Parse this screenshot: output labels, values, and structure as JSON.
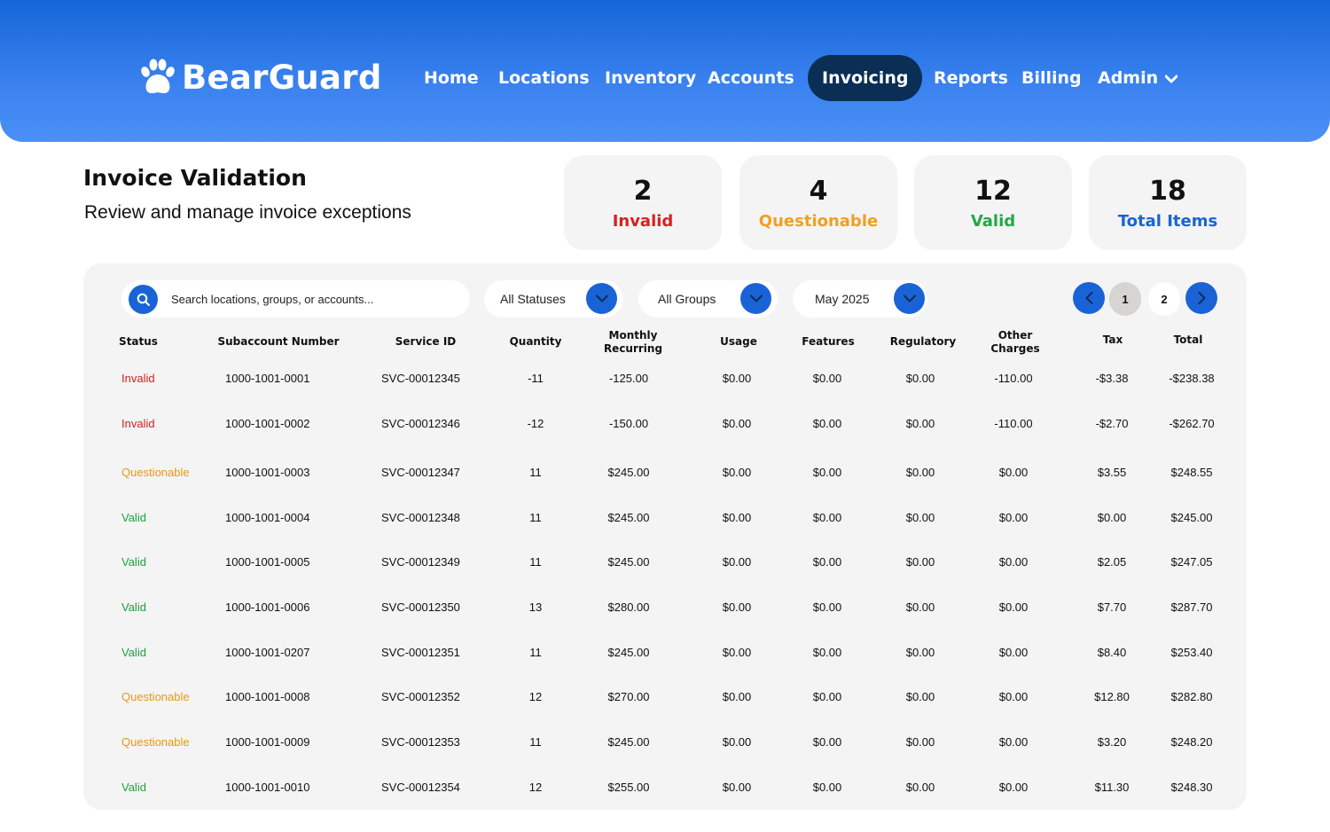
{
  "brand": {
    "name": "BearGuard",
    "logo_icon": "paw-icon"
  },
  "nav": {
    "items": [
      "Home",
      "Locations",
      "Inventory",
      "Accounts",
      "Invoicing",
      "Reports",
      "Billing",
      "Admin"
    ],
    "active": "Invoicing"
  },
  "page": {
    "title": "Invoice Validation",
    "subtitle": "Review and manage invoice exceptions"
  },
  "stats": [
    {
      "value": "2",
      "label": "Invalid",
      "color": "#d92020"
    },
    {
      "value": "4",
      "label": "Questionable",
      "color": "#f0a020"
    },
    {
      "value": "12",
      "label": "Valid",
      "color": "#22a845"
    },
    {
      "value": "18",
      "label": "Total Items",
      "color": "#1a63d6"
    }
  ],
  "filters": {
    "search_placeholder": "Search locations, groups, or accounts...",
    "status": "All Statuses",
    "group": "All Groups",
    "period": "May 2025"
  },
  "pagination": {
    "pages": [
      "1",
      "2"
    ],
    "current": "1"
  },
  "table": {
    "columns": [
      "Status",
      "Subaccount Number",
      "Service ID",
      "Quantity",
      "Monthly Recurring",
      "Usage",
      "Features",
      "Regulatory",
      "Other Charges",
      "Tax",
      "Total"
    ],
    "rows": [
      [
        "Invalid",
        "1000-1001-0001",
        "SVC-00012345",
        "-11",
        "-125.00",
        "$0.00",
        "$0.00",
        "$0.00",
        "-110.00",
        "-$3.38",
        "-$238.38"
      ],
      [
        "Invalid",
        "1000-1001-0002",
        "SVC-00012346",
        "-12",
        "-150.00",
        "$0.00",
        "$0.00",
        "$0.00",
        "-110.00",
        "-$2.70",
        "-$262.70"
      ],
      [
        "Questionable",
        "1000-1001-0003",
        "SVC-00012347",
        "11",
        "$245.00",
        "$0.00",
        "$0.00",
        "$0.00",
        "$0.00",
        "$3.55",
        "$248.55"
      ],
      [
        "Valid",
        "1000-1001-0004",
        "SVC-00012348",
        "11",
        "$245.00",
        "$0.00",
        "$0.00",
        "$0.00",
        "$0.00",
        "$0.00",
        "$245.00"
      ],
      [
        "Valid",
        "1000-1001-0005",
        "SVC-00012349",
        "11",
        "$245.00",
        "$0.00",
        "$0.00",
        "$0.00",
        "$0.00",
        "$2.05",
        "$247.05"
      ],
      [
        "Valid",
        "1000-1001-0006",
        "SVC-00012350",
        "13",
        "$280.00",
        "$0.00",
        "$0.00",
        "$0.00",
        "$0.00",
        "$7.70",
        "$287.70"
      ],
      [
        "Valid",
        "1000-1001-0207",
        "SVC-00012351",
        "11",
        "$245.00",
        "$0.00",
        "$0.00",
        "$0.00",
        "$0.00",
        "$8.40",
        "$253.40"
      ],
      [
        "Questionable",
        "1000-1001-0008",
        "SVC-00012352",
        "12",
        "$270.00",
        "$0.00",
        "$0.00",
        "$0.00",
        "$0.00",
        "$12.80",
        "$282.80"
      ],
      [
        "Questionable",
        "1000-1001-0009",
        "SVC-00012353",
        "11",
        "$245.00",
        "$0.00",
        "$0.00",
        "$0.00",
        "$0.00",
        "$3.20",
        "$248.20"
      ],
      [
        "Valid",
        "1000-1001-0010",
        "SVC-00012354",
        "12",
        "$255.00",
        "$0.00",
        "$0.00",
        "$0.00",
        "$0.00",
        "$11.30",
        "$248.30"
      ]
    ]
  }
}
